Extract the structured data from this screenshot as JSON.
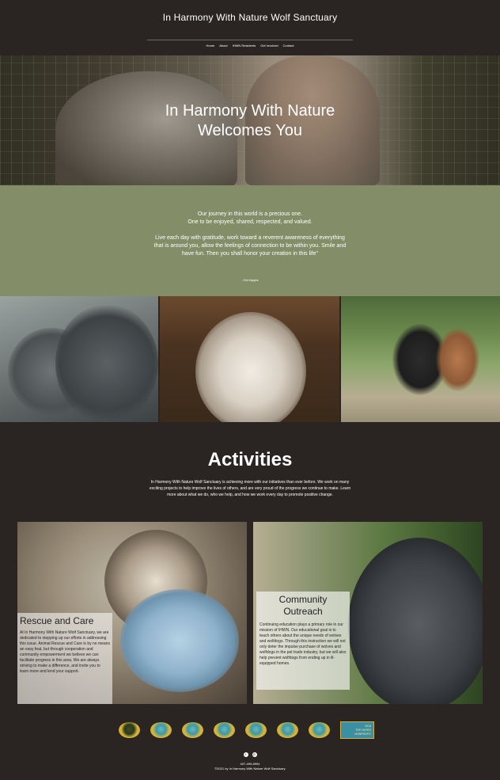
{
  "site": {
    "title": "In Harmony With Nature Wolf Sanctuary"
  },
  "nav": {
    "items": [
      {
        "label": "Home"
      },
      {
        "label": "About"
      },
      {
        "label": "IHWN Residents"
      },
      {
        "label": "Get Involved"
      },
      {
        "label": "Contact"
      }
    ]
  },
  "hero": {
    "line1": "In Harmony With Nature",
    "line2": "Welcomes You"
  },
  "quote": {
    "paragraph1_line1": "Our journey in this world is a precious one.",
    "paragraph1_line2": "One to be enjoyed, shared, respected, and valued.",
    "paragraph2": "Live each day with gratitude, work toward a reverent awareness of everything that is around you, allow the feelings of connection to be within you. Smile and have fun. Then you shall honor your creation in this life\"",
    "author": "- Kim Kappes"
  },
  "activities": {
    "title": "Activities",
    "description": "In Harmony With Nature Wolf Sanctuary is achieving more with our initiatives than ever before. We work on many exciting projects to help improve the lives of others, and are very proud of the progress we continue to make. Learn more about what we do, who we help, and how we work every day to promote positive change."
  },
  "cards": {
    "rescue": {
      "heading": "Rescue and Care",
      "text": "At In Harmony With Nature Wolf Sanctuary, we are dedicated to stepping up our efforts in addressing this issue. Animal Rescue and Care is by no means an easy feat, but through cooperation and community empowerment we believe we can facilitate progress in this area.  We are always striving to make a difference, and invite you to learn more and lend your support."
    },
    "outreach": {
      "heading_line1": "Community",
      "heading_line2": "Outreach",
      "text": "Continuing education plays a primary role in our mission of IHWN.  Our educational goal is to teach others about the unique needs of wolves and wolfdogs.  Through this instruction we will not only deter the impulse purchase of wolves and wolfdogs in the pet trade industry, but we will also help prevent wolfdogs from ending up in ill-equipped homes."
    }
  },
  "badges": {
    "top_rated_year": "2015",
    "top_rated_line1": "TOP-RATED",
    "top_rated_line2": "NONPROFIT"
  },
  "footer": {
    "social": [
      {
        "icon": "facebook-icon",
        "glyph": "f"
      },
      {
        "icon": "instagram-icon",
        "glyph": "◎"
      }
    ],
    "phone": "407-499-8994",
    "copyright": "©2021 by In Harmony With Nature Wolf Sanctuary"
  },
  "colors": {
    "background": "#2a2523",
    "quote_band": "#838e68",
    "text": "#ffffff"
  }
}
